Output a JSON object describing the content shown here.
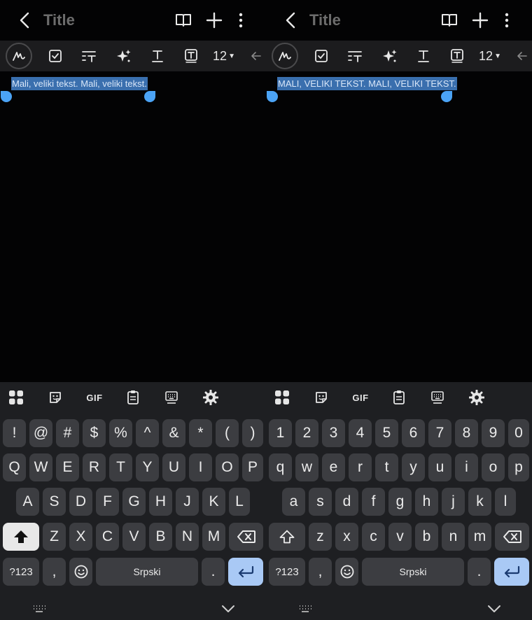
{
  "left": {
    "header": {
      "title": "Title"
    },
    "toolbar": {
      "font_size": "12"
    },
    "note": {
      "text": "Mali, veliki tekst. Mali, veliki tekst."
    },
    "keyboard": {
      "tools": {
        "gif_label": "GIF"
      },
      "rows": [
        [
          "!",
          "@",
          "#",
          "$",
          "%",
          "^",
          "&",
          "*",
          "(",
          ")"
        ],
        [
          "Q",
          "W",
          "E",
          "R",
          "T",
          "Y",
          "U",
          "I",
          "O",
          "P"
        ],
        [
          "A",
          "S",
          "D",
          "F",
          "G",
          "H",
          "J",
          "K",
          "L"
        ],
        [
          "Z",
          "X",
          "C",
          "V",
          "B",
          "N",
          "M"
        ]
      ],
      "sym_label": "?123",
      "comma": ",",
      "space_label": "Srpski",
      "period": "."
    }
  },
  "right": {
    "header": {
      "title": "Title"
    },
    "toolbar": {
      "font_size": "12"
    },
    "note": {
      "text": "MALI, VELIKI TEKST. MALI, VELIKI TEKST."
    },
    "keyboard": {
      "tools": {
        "gif_label": "GIF"
      },
      "rows": [
        [
          "1",
          "2",
          "3",
          "4",
          "5",
          "6",
          "7",
          "8",
          "9",
          "0"
        ],
        [
          "q",
          "w",
          "e",
          "r",
          "t",
          "y",
          "u",
          "i",
          "o",
          "p"
        ],
        [
          "a",
          "s",
          "d",
          "f",
          "g",
          "h",
          "j",
          "k",
          "l"
        ],
        [
          "z",
          "x",
          "c",
          "v",
          "b",
          "n",
          "m"
        ]
      ],
      "sym_label": "?123",
      "comma": ",",
      "space_label": "Srpski",
      "period": "."
    }
  },
  "colors": {
    "background": "#030304",
    "toolbar": "#1c1c1e",
    "keyboard": "#1e1f22",
    "key": "#3c3d41",
    "selection": "#3a6fae",
    "handle": "#4ba3f5",
    "enter_key": "#a9c9f5"
  },
  "icons": [
    "back-icon",
    "book-icon",
    "plus-icon",
    "more-icon",
    "pen-icon",
    "checkbox-icon",
    "text-style-icon",
    "sparkle-icon",
    "underline-text-icon",
    "text-box-icon",
    "arrow-left-icon",
    "apps-grid-icon",
    "sticker-icon",
    "clipboard-icon",
    "keyboard-icon",
    "gear-icon",
    "shift-icon",
    "backspace-icon",
    "emoji-icon",
    "enter-icon",
    "keyboard-switch-icon",
    "chevron-down-icon"
  ]
}
